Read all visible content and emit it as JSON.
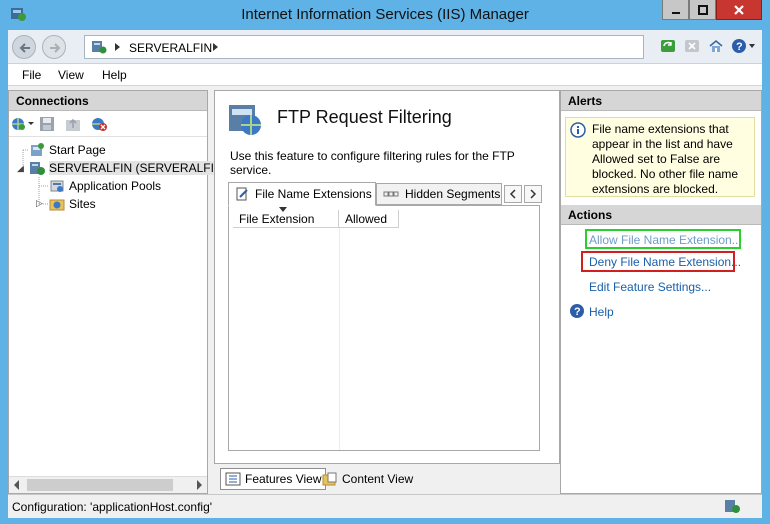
{
  "window": {
    "title": "Internet Information Services (IIS) Manager",
    "accent": "#5fb2e6"
  },
  "address": {
    "crumbs": [
      "SERVERALFIN"
    ]
  },
  "menu": {
    "items": [
      "File",
      "View",
      "Help"
    ]
  },
  "connections": {
    "header": "Connections",
    "tree": [
      {
        "label": "Start Page",
        "icon": "start-page-icon"
      },
      {
        "label": "SERVERALFIN (SERVERALFIN\\",
        "icon": "server-icon"
      },
      {
        "label": "Application Pools",
        "icon": "app-pools-icon"
      },
      {
        "label": "Sites",
        "icon": "sites-icon"
      }
    ]
  },
  "feature": {
    "title": "FTP Request Filtering",
    "description": "Use this feature to configure filtering rules for the FTP service.",
    "tabs": [
      "File Name Extensions",
      "Hidden Segments"
    ],
    "columns": [
      "File Extension",
      "Allowed"
    ],
    "views": [
      "Features View",
      "Content View"
    ]
  },
  "alerts": {
    "header": "Alerts",
    "message": "File name extensions that appear in the list and have Allowed set to False are blocked. No other file name extensions are blocked."
  },
  "actions": {
    "header": "Actions",
    "items": [
      "Allow File Name Extension...",
      "Deny File Name Extension...",
      "Edit Feature Settings...",
      "Help"
    ]
  },
  "status": {
    "text": "Configuration: 'applicationHost.config'"
  },
  "highlight_colors": {
    "green": "#29cf2e",
    "red": "#d11f1f"
  }
}
